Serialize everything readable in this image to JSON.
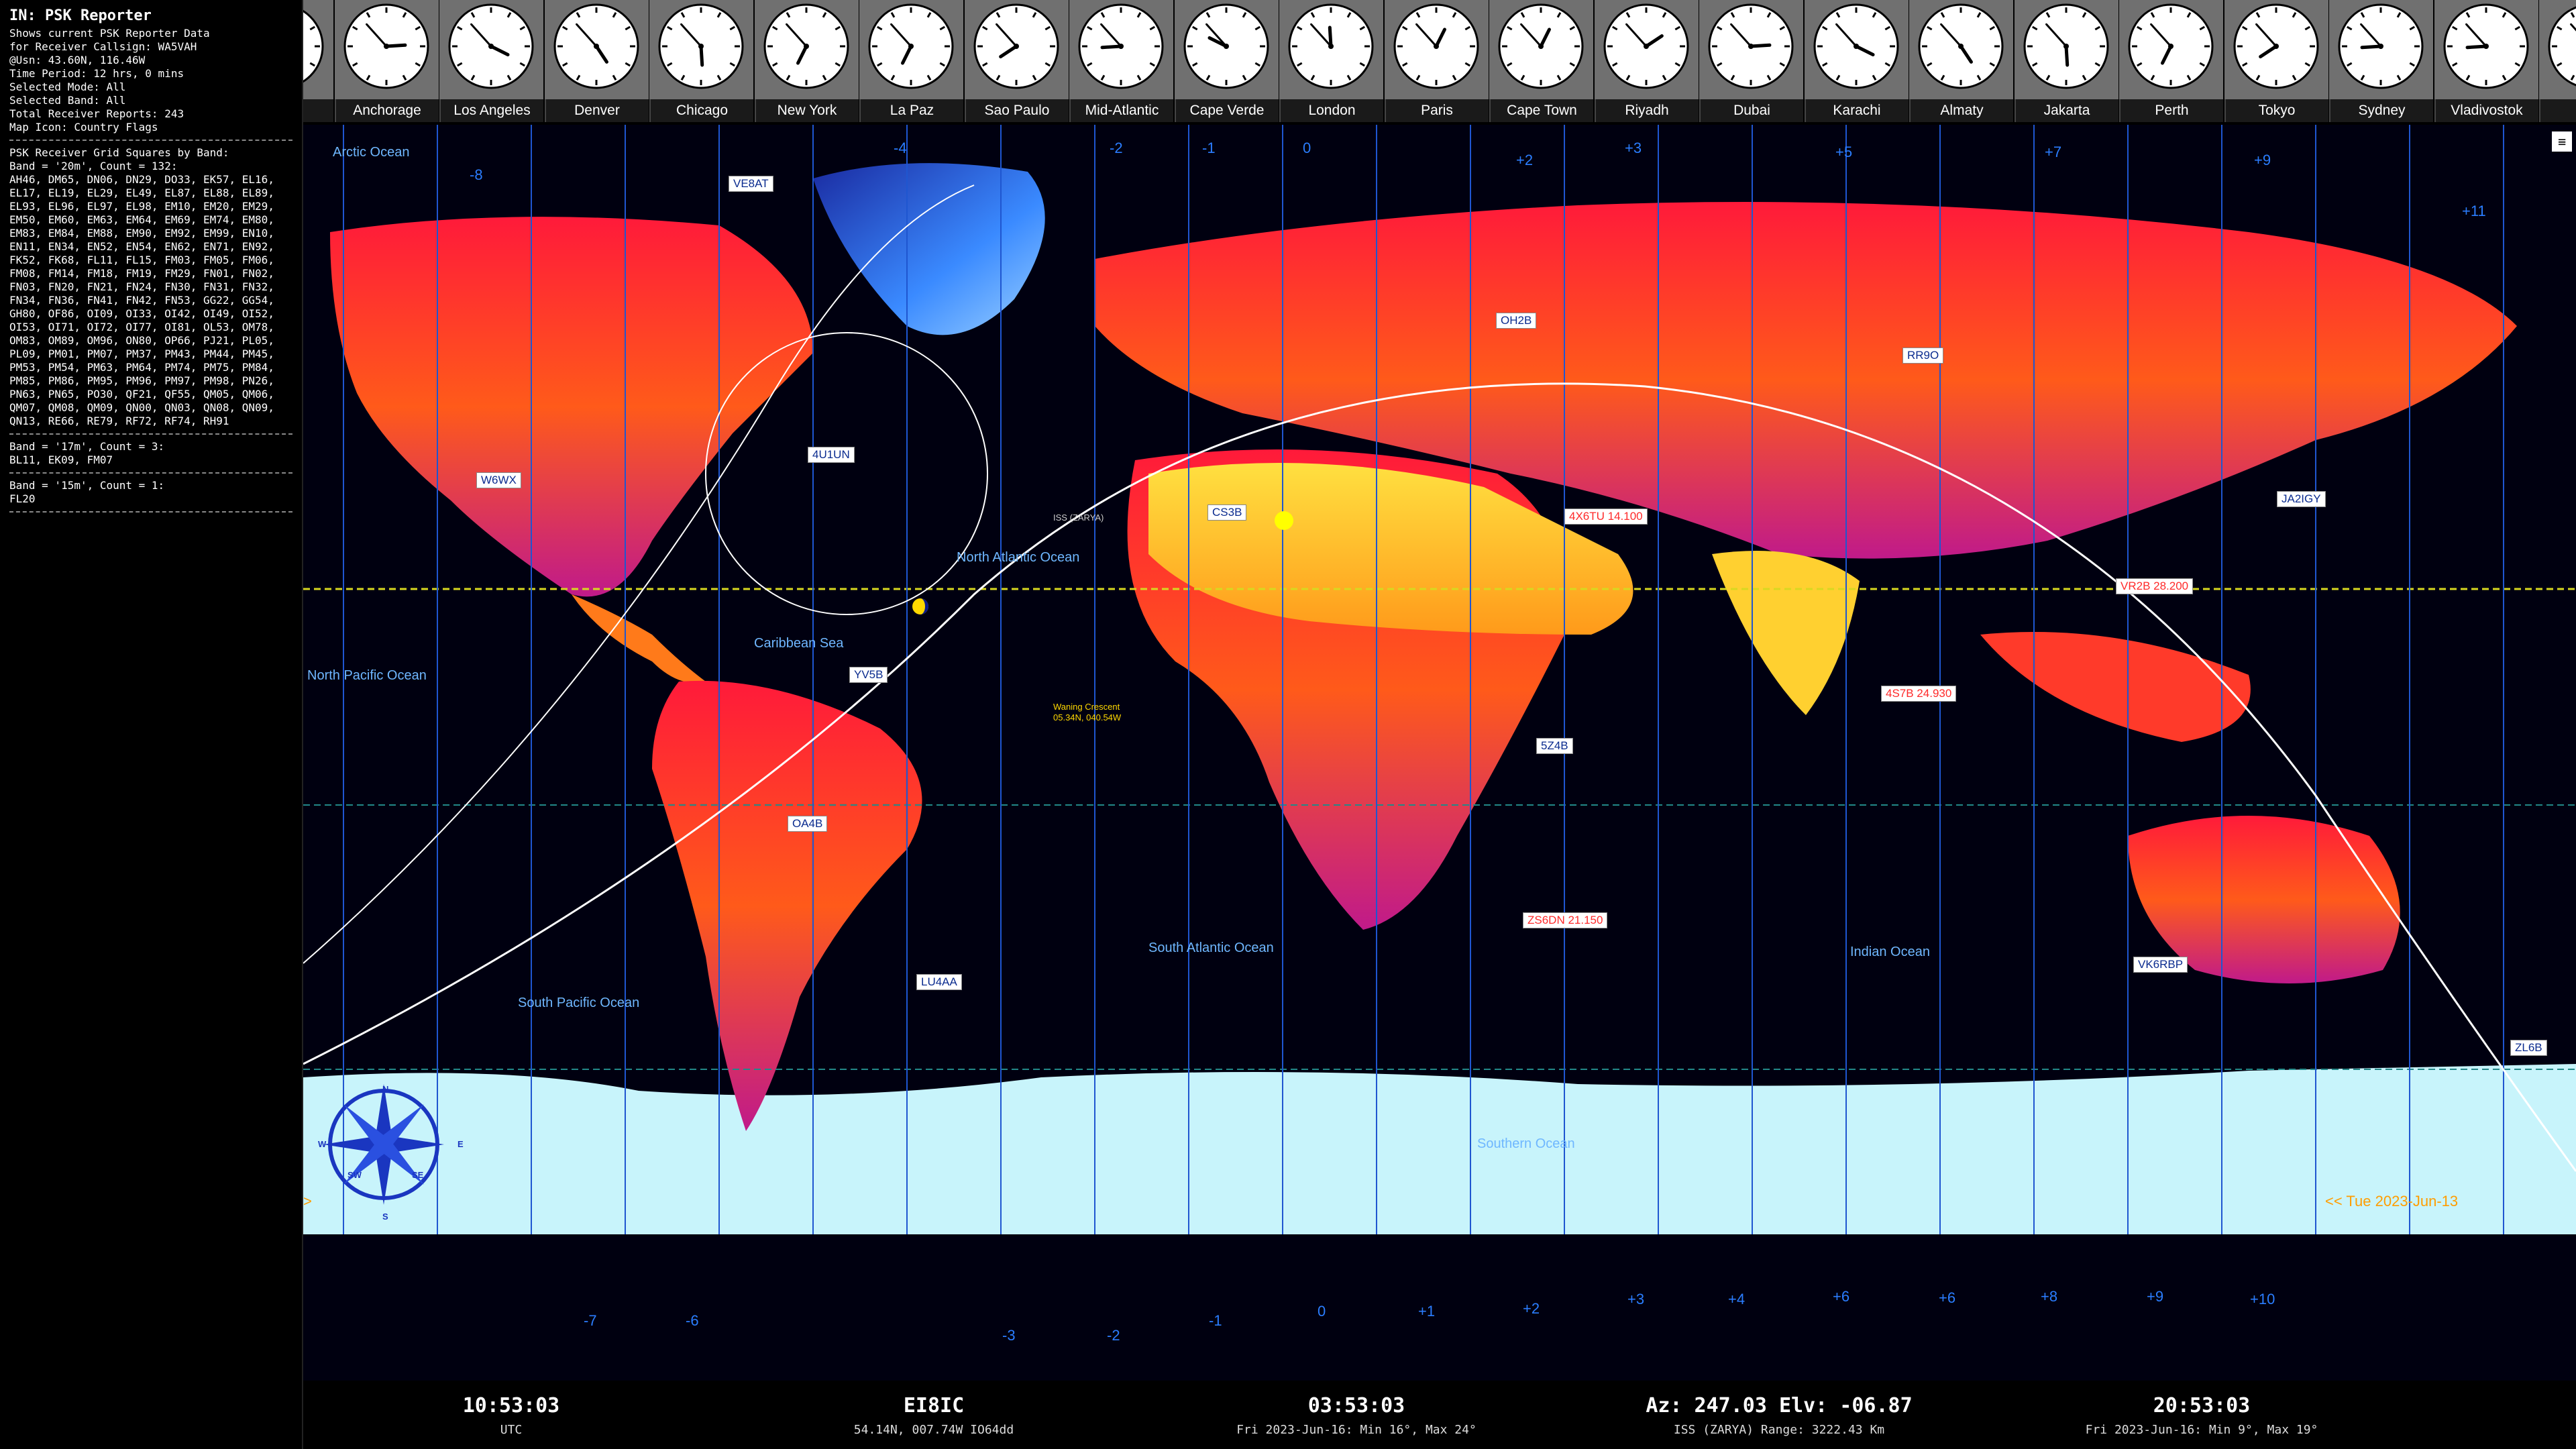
{
  "info": {
    "title": "IN: PSK Reporter",
    "lines": [
      "Shows current PSK Reporter Data",
      "for Receiver Callsign: WA5VAH",
      "@Usn: 43.60N, 116.46W",
      "Time Period: 12 hrs, 0 mins",
      "Selected Mode: All",
      "Selected Band: All",
      "Total Receiver Reports: 243",
      "Map Icon: Country Flags"
    ],
    "grid_title": "PSK Receiver Grid Squares by Band:",
    "band20_header": "Band = '20m', Count = 132:",
    "band20_grids": "AH46, DM65, DN06, DN29, DO33, EK57, EL16, EL17, EL19, EL29, EL49, EL87, EL88, EL89, EL93, EL96, EL97, EL98, EM10, EM20, EM29, EM50, EM60, EM63, EM64, EM69, EM74, EM80, EM83, EM84, EM88, EM90, EM92, EM99, EN10, EN11, EN34, EN52, EN54, EN62, EN71, EN92, FK52, FK68, FL11, FL15, FM03, FM05, FM06, FM08, FM14, FM18, FM19, FM29, FN01, FN02, FN03, FN20, FN21, FN24, FN30, FN31, FN32, FN34, FN36, FN41, FN42, FN53, GG22, GG54, GH80, OF86, OI09, OI33, OI42, OI49, OI52, OI53, OI71, OI72, OI77, OI81, OL53, OM78, OM83, OM89, OM96, ON80, OP66, PJ21, PL05, PL09, PM01, PM07, PM37, PM43, PM44, PM45, PM53, PM54, PM63, PM64, PM74, PM75, PM84, PM85, PM86, PM95, PM96, PM97, PM98, PN26, PN63, PN65, PO30, QF21, QF55, QM05, QM06, QM07, QM08, QM09, QN00, QN03, QN08, QN09, QN13, RE66, RE79, RF72, RF74, RH91",
    "band17_header": "Band = '17m', Count = 3:",
    "band17_grids": "BL11, EK09, FM07",
    "band15_header": "Band = '15m', Count = 1:",
    "band15_grids": "FL20"
  },
  "clocks": [
    {
      "city": "u",
      "h": 12,
      "m": 53
    },
    {
      "city": "Anchorage",
      "h": 2,
      "m": 53
    },
    {
      "city": "Los Angeles",
      "h": 3,
      "m": 53
    },
    {
      "city": "Denver",
      "h": 4,
      "m": 53
    },
    {
      "city": "Chicago",
      "h": 5,
      "m": 53
    },
    {
      "city": "New York",
      "h": 6,
      "m": 53
    },
    {
      "city": "La Paz",
      "h": 6,
      "m": 53
    },
    {
      "city": "Sao Paulo",
      "h": 7,
      "m": 53
    },
    {
      "city": "Mid-Atlantic",
      "h": 8,
      "m": 53
    },
    {
      "city": "Cape Verde",
      "h": 9,
      "m": 53
    },
    {
      "city": "London",
      "h": 11,
      "m": 53
    },
    {
      "city": "Paris",
      "h": 12,
      "m": 53
    },
    {
      "city": "Cape Town",
      "h": 12,
      "m": 53
    },
    {
      "city": "Riyadh",
      "h": 1,
      "m": 53
    },
    {
      "city": "Dubai",
      "h": 2,
      "m": 53
    },
    {
      "city": "Karachi",
      "h": 3,
      "m": 53
    },
    {
      "city": "Almaty",
      "h": 4,
      "m": 53
    },
    {
      "city": "Jakarta",
      "h": 5,
      "m": 53
    },
    {
      "city": "Perth",
      "h": 6,
      "m": 53
    },
    {
      "city": "Tokyo",
      "h": 7,
      "m": 53
    },
    {
      "city": "Sydney",
      "h": 8,
      "m": 53
    },
    {
      "city": "Vladivostok",
      "h": 8,
      "m": 53
    },
    {
      "city": "Auck",
      "h": 10,
      "m": 53
    }
  ],
  "map": {
    "oceans": [
      {
        "name": "Arctic Ocean"
      },
      {
        "name": "North Atlantic Ocean"
      },
      {
        "name": "Caribbean Sea"
      },
      {
        "name": "North Pacific Ocean"
      },
      {
        "name": "South Atlantic Ocean"
      },
      {
        "name": "South Pacific Ocean"
      },
      {
        "name": "Indian Ocean"
      },
      {
        "name": "Southern Ocean"
      }
    ],
    "callsigns": [
      {
        "label": "VE8AT",
        "red": false
      },
      {
        "label": "4U1UN",
        "red": false
      },
      {
        "label": "W6WX",
        "red": false
      },
      {
        "label": "OH2B",
        "red": false
      },
      {
        "label": "RR9O",
        "red": false
      },
      {
        "label": "CS3B",
        "red": false
      },
      {
        "label": "4X6TU 14.100",
        "red": true
      },
      {
        "label": "JA2IGY",
        "red": false
      },
      {
        "label": "VR2B 28.200",
        "red": true
      },
      {
        "label": "4S7B 24.930",
        "red": true
      },
      {
        "label": "YV5B",
        "red": false
      },
      {
        "label": "OA4B",
        "red": false
      },
      {
        "label": "5Z4B",
        "red": false
      },
      {
        "label": "ZS6DN 21.150",
        "red": true
      },
      {
        "label": "LU4AA",
        "red": false
      },
      {
        "label": "VK6RBP",
        "red": false
      },
      {
        "label": "ZL6B",
        "red": false
      }
    ],
    "tz_top": [
      "-8",
      "-4",
      "-2",
      "-1",
      "0",
      "+2",
      "+3",
      "+5",
      "+7",
      "+9",
      "+11"
    ],
    "tz_bottom": [
      "-7",
      "-6",
      "-3",
      "-2",
      "-1",
      "0",
      "+1",
      "+2",
      "+3",
      "+4",
      "+6",
      "+6",
      "+8",
      "+9",
      "+10"
    ],
    "date_right": "<< Tue 2023-Jun-13",
    "date_left": ">",
    "moon_label": "Waning Crescent",
    "moon_coords": "05.34N, 040.54W",
    "iss_label": "ISS (ZARYA)",
    "compass": {
      "n": "N",
      "s": "S",
      "e": "E",
      "w": "W",
      "se": "SE",
      "sw": "SW"
    }
  },
  "bottom": {
    "utc_time": "10:53:03",
    "utc_label": "UTC",
    "callsign": "EI8IC",
    "location": "54.14N, 007.74W  IO64dd",
    "local_time": "03:53:03",
    "local_weather": "Fri 2023-Jun-16: Min 16°, Max 24°",
    "az_elv": "Az: 247.03  Elv: -06.87",
    "sat_info": "ISS (ZARYA)  Range: 3222.43 Km",
    "dx_time": "20:53:03",
    "dx_weather": "Fri 2023-Jun-16: Min 9°, Max 19°"
  },
  "colors": {
    "accent": "#2b7dff",
    "land_hot": "#ff2a1a",
    "land_warm": "#ffe040",
    "ice": "#c8f4fb"
  }
}
